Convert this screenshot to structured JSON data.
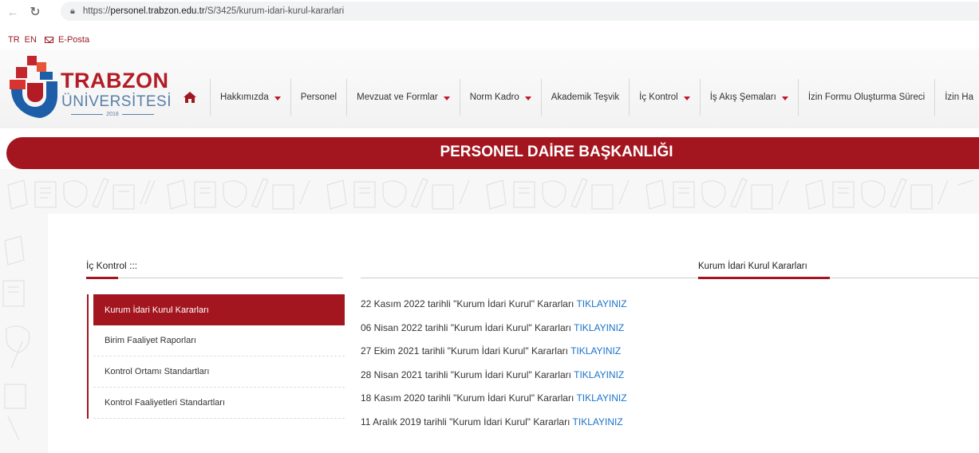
{
  "browser": {
    "url_prefix": "https://",
    "url_host": "personel.trabzon.edu.tr",
    "url_path": "/S/3425/kurum-idari-kurul-kararlari"
  },
  "utility": {
    "lang_tr": "TR",
    "lang_en": "EN",
    "email": "E-Posta"
  },
  "logo": {
    "title": "TRABZON",
    "subtitle": "ÜNİVERSİTESİ",
    "year": "2018"
  },
  "nav": {
    "items": [
      {
        "label": "Hakkımızda",
        "dropdown": true
      },
      {
        "label": "Personel",
        "dropdown": false
      },
      {
        "label": "Mevzuat ve Formlar",
        "dropdown": true
      },
      {
        "label": "Norm Kadro",
        "dropdown": true
      },
      {
        "label": "Akademik Teşvik",
        "dropdown": false
      },
      {
        "label": "İç Kontrol",
        "dropdown": true
      },
      {
        "label": "İş Akış Şemaları",
        "dropdown": true
      },
      {
        "label": "İzin Formu Oluşturma Süreci",
        "dropdown": false
      },
      {
        "label": "İzin Ha",
        "dropdown": false
      }
    ]
  },
  "banner": {
    "title": "PERSONEL DAİRE BAŞKANLIĞI"
  },
  "sidebar": {
    "title": "İç Kontrol :::",
    "items": [
      {
        "label": "Kurum İdari Kurul Kararları",
        "active": true
      },
      {
        "label": "Birim Faaliyet Raporları",
        "active": false
      },
      {
        "label": "Kontrol Ortamı Standartları",
        "active": false
      },
      {
        "label": "Kontrol Faaliyetleri Standartları",
        "active": false
      }
    ]
  },
  "main": {
    "title": "Kurum İdari Kurul Kararları",
    "links": [
      {
        "text": "22 Kasım 2022 tarihli \"Kurum İdari Kurul\" Kararları",
        "link": "TIKLAYINIZ"
      },
      {
        "text": "06 Nisan 2022 tarihli \"Kurum İdari Kurul\" Kararları",
        "link": "TIKLAYINIZ"
      },
      {
        "text": "27 Ekim 2021 tarihli \"Kurum İdari Kurul\" Kararları",
        "link": "TIKLAYINIZ"
      },
      {
        "text": "28 Nisan 2021 tarihli \"Kurum İdari Kurul\" Kararları",
        "link": "TIKLAYINIZ"
      },
      {
        "text": "18 Kasım 2020 tarihli \"Kurum İdari Kurul\" Kararları",
        "link": "TIKLAYINIZ"
      },
      {
        "text": "11 Aralık 2019 tarihli \"Kurum İdari Kurul\" Kararları",
        "link": "TIKLAYINIZ"
      }
    ]
  },
  "colors": {
    "brand_red": "#a3161f",
    "link_blue": "#1a73c9"
  }
}
